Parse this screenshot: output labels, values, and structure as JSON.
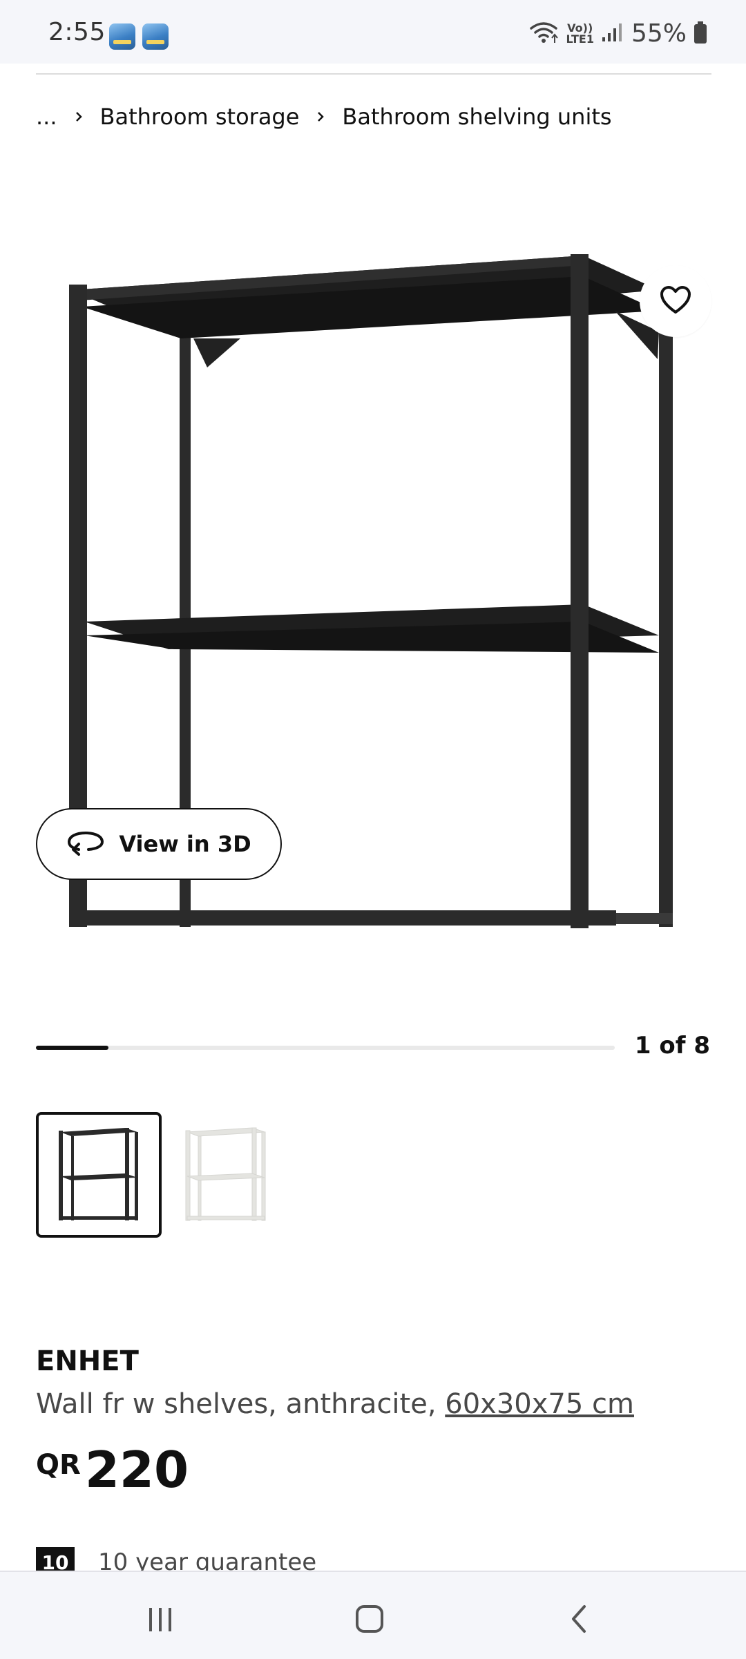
{
  "status_bar": {
    "time": "2:55",
    "lte_top": "Vo))",
    "lte_bottom": "LTE1",
    "battery": "55%",
    "icons": [
      "app-icon",
      "app-icon",
      "wifi-icon",
      "signal-icon",
      "battery-icon"
    ]
  },
  "breadcrumb": {
    "ellipsis": "...",
    "items": [
      "Bathroom storage",
      "Bathroom shelving units"
    ]
  },
  "gallery": {
    "view3d_label": "View in 3D",
    "pager_text": "1 of 8",
    "current_index": 1,
    "total": 8,
    "thumbnails": [
      {
        "variant": "anthracite",
        "color": "#2a2a2a",
        "selected": true
      },
      {
        "variant": "white",
        "color": "#e4e4e0",
        "selected": false
      }
    ]
  },
  "product": {
    "name": "ENHET",
    "description": "Wall fr w shelves, anthracite, ",
    "dimensions": "60x30x75 cm",
    "currency": "QR",
    "price": "220",
    "frame_color": "#2b2b2b"
  },
  "guarantee": {
    "badge": "10",
    "text": "10 year guarantee"
  },
  "nav_bar": {
    "icons": [
      "recents-icon",
      "home-icon",
      "back-icon"
    ]
  }
}
